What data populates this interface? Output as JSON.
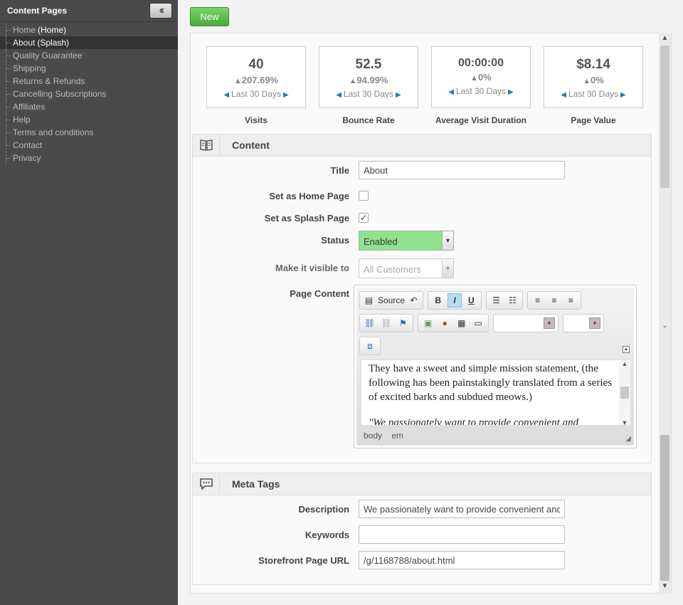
{
  "sidebar": {
    "title": "Content Pages",
    "collapse_icon": "double-chevron-left-icon",
    "items": [
      {
        "label": "Home",
        "tag": "(Home)",
        "active": false
      },
      {
        "label": "About",
        "tag": "(Splash)",
        "active": true
      },
      {
        "label": "Quality Guarantee",
        "tag": "",
        "active": false
      },
      {
        "label": "Shipping",
        "tag": "",
        "active": false
      },
      {
        "label": "Returns & Refunds",
        "tag": "",
        "active": false
      },
      {
        "label": "Cancelling Subscriptions",
        "tag": "",
        "active": false
      },
      {
        "label": "Affiliates",
        "tag": "",
        "active": false
      },
      {
        "label": "Help",
        "tag": "",
        "active": false
      },
      {
        "label": "Terms and conditions",
        "tag": "",
        "active": false
      },
      {
        "label": "Contact",
        "tag": "",
        "active": false
      },
      {
        "label": "Privacy",
        "tag": "",
        "active": false
      }
    ]
  },
  "toolbar": {
    "new_label": "New"
  },
  "stats": [
    {
      "value": "40",
      "change": "207.69%",
      "period": "Last 30 Days",
      "label": "Visits"
    },
    {
      "value": "52.5",
      "change": "94.99%",
      "period": "Last 30 Days",
      "label": "Bounce Rate"
    },
    {
      "value": "00:00:00",
      "change": "0%",
      "period": "Last 30 Days",
      "label": "Average Visit Duration"
    },
    {
      "value": "$8.14",
      "change": "0%",
      "period": "Last 30 Days",
      "label": "Page Value"
    }
  ],
  "content_section": {
    "title": "Content",
    "icon": "book-icon",
    "title_label": "Title",
    "title_value": "About",
    "home_label": "Set as Home Page",
    "home_checked": false,
    "splash_label": "Set as Splash Page",
    "splash_checked": true,
    "status_label": "Status",
    "status_value": "Enabled",
    "visible_label": "Make it visible to",
    "visible_value": "All Customers",
    "page_content_label": "Page Content"
  },
  "editor": {
    "source_label": "Source",
    "paragraph1": "They have a sweet and simple mission statement, (the following has been painstakingly translated from a series of excited barks and subdued meows.)",
    "paragraph2": "\"We passionately want to provide convenient and",
    "path": [
      "body",
      "em"
    ]
  },
  "meta_section": {
    "title": "Meta Tags",
    "icon": "speech-bubble-icon",
    "description_label": "Description",
    "description_value": "We passionately want to provide convenient and",
    "keywords_label": "Keywords",
    "keywords_value": "",
    "url_label": "Storefront Page URL",
    "url_value": "/g/1168788/about.html"
  },
  "colors": {
    "sidebar_bg": "#4a4a4a",
    "new_button": "#4aab38",
    "status_enabled": "#8fe38c",
    "link_arrow": "#1a7fbf"
  }
}
